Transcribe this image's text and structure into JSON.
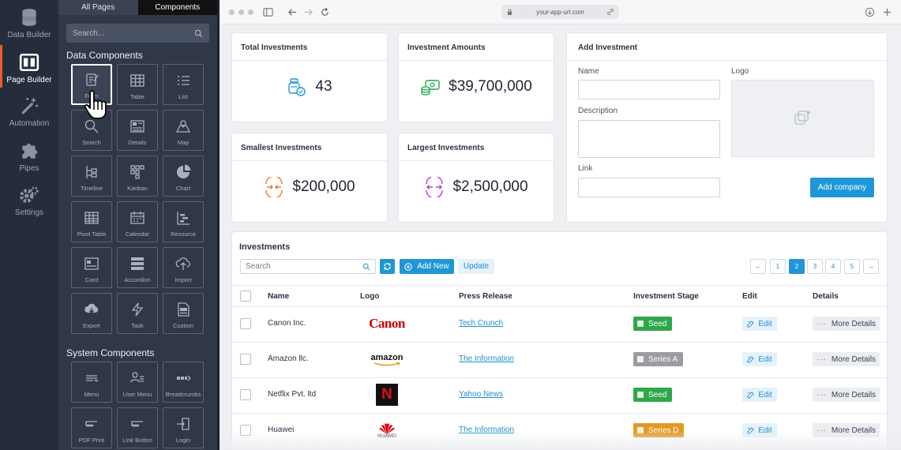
{
  "rail": {
    "items": [
      {
        "label": "Data Builder",
        "icon": "database-icon"
      },
      {
        "label": "Page Builder",
        "icon": "layout-icon"
      },
      {
        "label": "Automation",
        "icon": "magic-wand-icon"
      },
      {
        "label": "Pipes",
        "icon": "puzzle-icon"
      },
      {
        "label": "Settings",
        "icon": "gear-icon"
      }
    ],
    "active_index": 1
  },
  "panel": {
    "tabs": [
      "All Pages",
      "Components"
    ],
    "active_tab": 1,
    "search_placeholder": "Search...",
    "data_heading": "Data Components",
    "data_components": [
      {
        "label": "Form",
        "icon": "form-icon"
      },
      {
        "label": "Table",
        "icon": "table-icon"
      },
      {
        "label": "List",
        "icon": "list-icon"
      },
      {
        "label": "Search",
        "icon": "search-icon"
      },
      {
        "label": "Details",
        "icon": "details-icon"
      },
      {
        "label": "Map",
        "icon": "map-icon"
      },
      {
        "label": "Timeline",
        "icon": "timeline-icon"
      },
      {
        "label": "Kanban",
        "icon": "kanban-icon"
      },
      {
        "label": "Chart",
        "icon": "chart-icon"
      },
      {
        "label": "Pivot Table",
        "icon": "pivot-table-icon"
      },
      {
        "label": "Calendar",
        "icon": "calendar-icon"
      },
      {
        "label": "Resource",
        "icon": "resource-icon"
      },
      {
        "label": "Card",
        "icon": "card-icon"
      },
      {
        "label": "Accordion",
        "icon": "accordion-icon"
      },
      {
        "label": "Import",
        "icon": "cloud-upload-icon"
      },
      {
        "label": "Export",
        "icon": "cloud-download-icon"
      },
      {
        "label": "Task",
        "icon": "bolt-icon"
      },
      {
        "label": "Custom",
        "icon": "html-file-icon"
      }
    ],
    "system_heading": "System Components",
    "system_components": [
      {
        "label": "Menu",
        "icon": "menu-icon"
      },
      {
        "label": "User Menu",
        "icon": "user-menu-icon"
      },
      {
        "label": "Breadcrumbs",
        "icon": "breadcrumbs-icon"
      },
      {
        "label": "PDF Print",
        "icon": "pdf-print-icon"
      },
      {
        "label": "Link Button",
        "icon": "link-button-icon"
      },
      {
        "label": "Login",
        "icon": "login-icon"
      }
    ]
  },
  "browser": {
    "url": "your-app-url.com"
  },
  "stats": [
    {
      "title": "Total Investments",
      "value": "43",
      "icon": "coins-icon",
      "color": "#2196d3"
    },
    {
      "title": "Investment Amounts",
      "value": "$39,700,000",
      "icon": "money-icon",
      "color": "#22a74d"
    },
    {
      "title": "Smallest Investments",
      "value": "$200,000",
      "icon": "arrows-in-icon",
      "color": "#ee7b31"
    },
    {
      "title": "Largest Investments",
      "value": "$2,500,000",
      "icon": "arrows-out-icon",
      "color": "#c23bd0"
    }
  ],
  "add_form": {
    "title": "Add Investment",
    "name_label": "Name",
    "description_label": "Description",
    "link_label": "Link",
    "logo_label": "Logo",
    "submit_label": "Add company"
  },
  "investments": {
    "title": "Investments",
    "search_placeholder": "Search",
    "add_new_label": "Add New",
    "update_label": "Update",
    "pagination": [
      "←",
      "1",
      "2",
      "3",
      "4",
      "5",
      "→"
    ],
    "active_page": "2",
    "columns": [
      "Name",
      "Logo",
      "Press Release",
      "Investment Stage",
      "Edit",
      "Details"
    ],
    "edit_label": "Edit",
    "details_label": "More Details",
    "rows": [
      {
        "name": "Canon Inc.",
        "logo": "Canon",
        "press": "Tech Crunch",
        "stage": "Seed",
        "stage_color": "#2ea84a"
      },
      {
        "name": "Amazon llc.",
        "logo": "amazon",
        "press": "The Information",
        "stage": "Series A",
        "stage_color": "#9a9ca1"
      },
      {
        "name": "Netflix Pvt. ltd",
        "logo": "N",
        "press": "Yahoo News",
        "stage": "Seed",
        "stage_color": "#2ea84a"
      },
      {
        "name": "Huawei",
        "logo": "HUAWEI",
        "press": "The Information",
        "stage": "Series D",
        "stage_color": "#e39a24"
      }
    ]
  }
}
